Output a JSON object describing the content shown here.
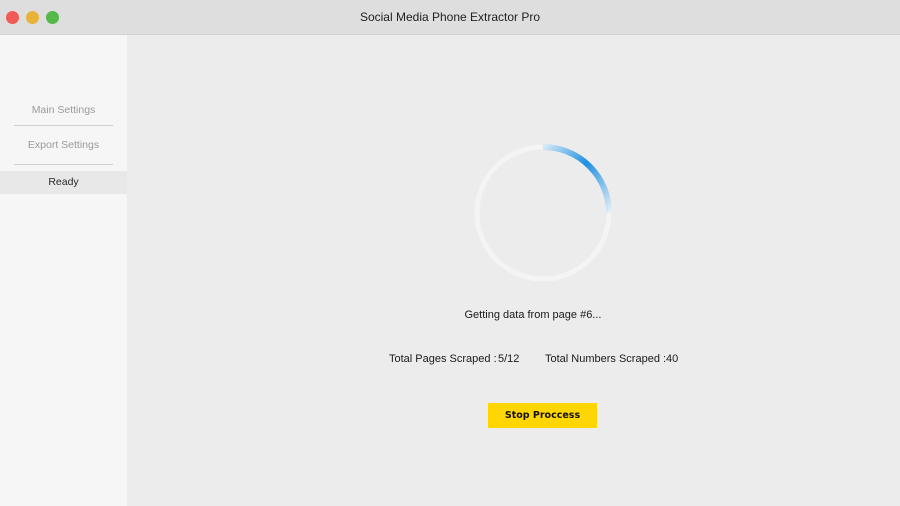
{
  "window": {
    "title": "Social Media Phone Extractor Pro"
  },
  "sidebar": {
    "items": [
      {
        "label": "Main Settings"
      },
      {
        "label": "Export Settings"
      },
      {
        "label": "Ready"
      }
    ]
  },
  "main": {
    "status": "Getting data from page #6...",
    "stats": {
      "pages_label": "Total Pages Scraped :",
      "pages_value": "5/12",
      "numbers_label": "Total Numbers Scraped :",
      "numbers_value": "40"
    },
    "stop_label": "Stop Proccess"
  },
  "colors": {
    "accent": "#1e8fe0",
    "button": "#ffd600",
    "close": "#f25b55",
    "minimize": "#e9b33a",
    "maximize": "#54b948"
  },
  "icons": [
    "close-window-icon",
    "minimize-window-icon",
    "maximize-window-icon",
    "loading-spinner-icon"
  ]
}
